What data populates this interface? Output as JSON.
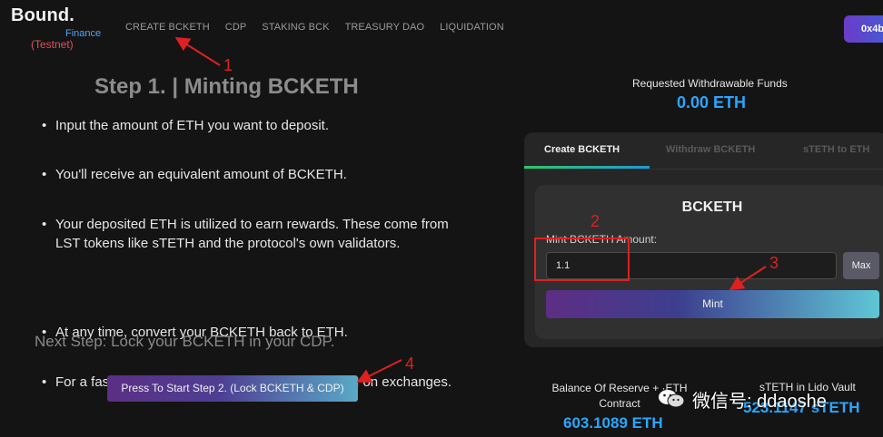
{
  "brand": {
    "name": "Bound.",
    "sub": "Finance",
    "network": "(Testnet)"
  },
  "nav": {
    "items": [
      "CREATE BCKETH",
      "CDP",
      "STAKING BCK",
      "TREASURY DAO",
      "LIQUIDATION"
    ],
    "wallet": "0x4b"
  },
  "step": {
    "title": "Step 1. | Minting BCKETH",
    "bullets": [
      "Input the amount of ETH you want to deposit.",
      "You'll receive an equivalent amount of BCKETH.",
      "Your deposited ETH is utilized to earn rewards. These come from LST tokens like sTETH and the protocol's own validators.",
      "At any time, convert your BCKETH back to ETH.",
      "For a faster ETH return, consider trading BCKETH on exchanges."
    ],
    "next": "Next Step: Lock your BCKETH in your CDP.",
    "start_button": "Press To Start Step 2. (Lock BCKETH & CDP)"
  },
  "funds": {
    "label": "Requested Withdrawable Funds",
    "value": "0.00 ETH"
  },
  "card": {
    "tabs": [
      "Create BCKETH",
      "Withdraw BCKETH",
      "sTETH to ETH"
    ],
    "title": "BCKETH",
    "mint_label": "Mint BCKETH Amount:",
    "amount_value": "1.1",
    "max_label": "Max",
    "mint_button": "Mint"
  },
  "stats": {
    "reserve_label": "Balance Of Reserve + ·",
    "reserve_label_2": "Contract",
    "reserve_label_tail": "ETH",
    "reserve_value": "603.1089 ETH",
    "lido_label": "sTETH in Lido Vault",
    "lido_value": "523.1147 sTETH"
  },
  "watermark": {
    "text": "微信号: ddaoshe"
  },
  "annotations": {
    "n1": "1",
    "n2": "2",
    "n3": "3",
    "n4": "4"
  },
  "colors": {
    "accent": "#2aa6ff",
    "annotation": "#e02020",
    "background": "#141414"
  }
}
